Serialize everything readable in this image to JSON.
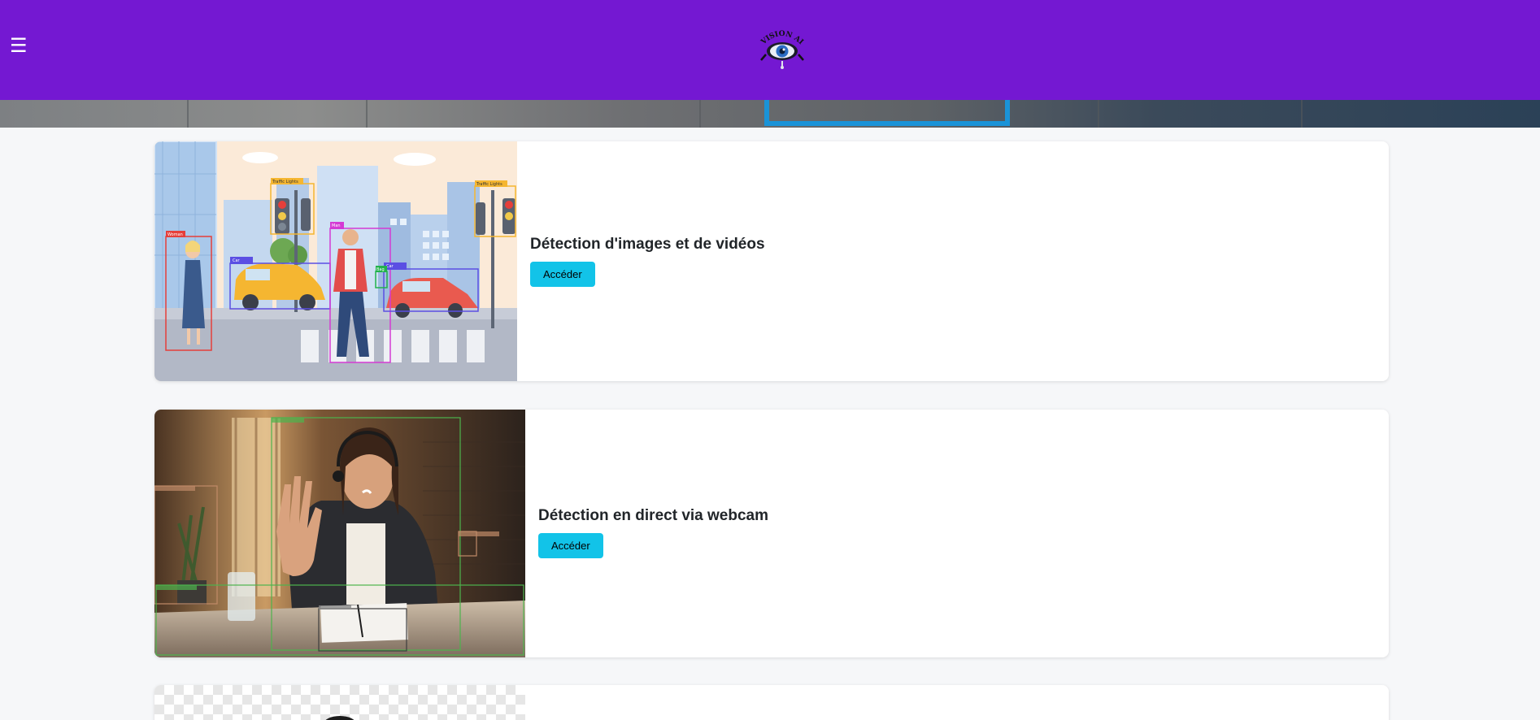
{
  "header": {
    "menu_icon": "hamburger-menu-icon",
    "logo_text": "VISION AI",
    "brand_color": "#7418d2"
  },
  "cards": [
    {
      "title": "Détection d'images et de vidéos",
      "button_label": "Accéder"
    },
    {
      "title": "Détection en direct via webcam",
      "button_label": "Accéder"
    }
  ],
  "illustration_labels": {
    "traffic_light": "Traffic Lights",
    "woman": "Woman",
    "man": "Man",
    "car": "Car",
    "bag": "Bag"
  },
  "accent_color": "#12c3e8"
}
